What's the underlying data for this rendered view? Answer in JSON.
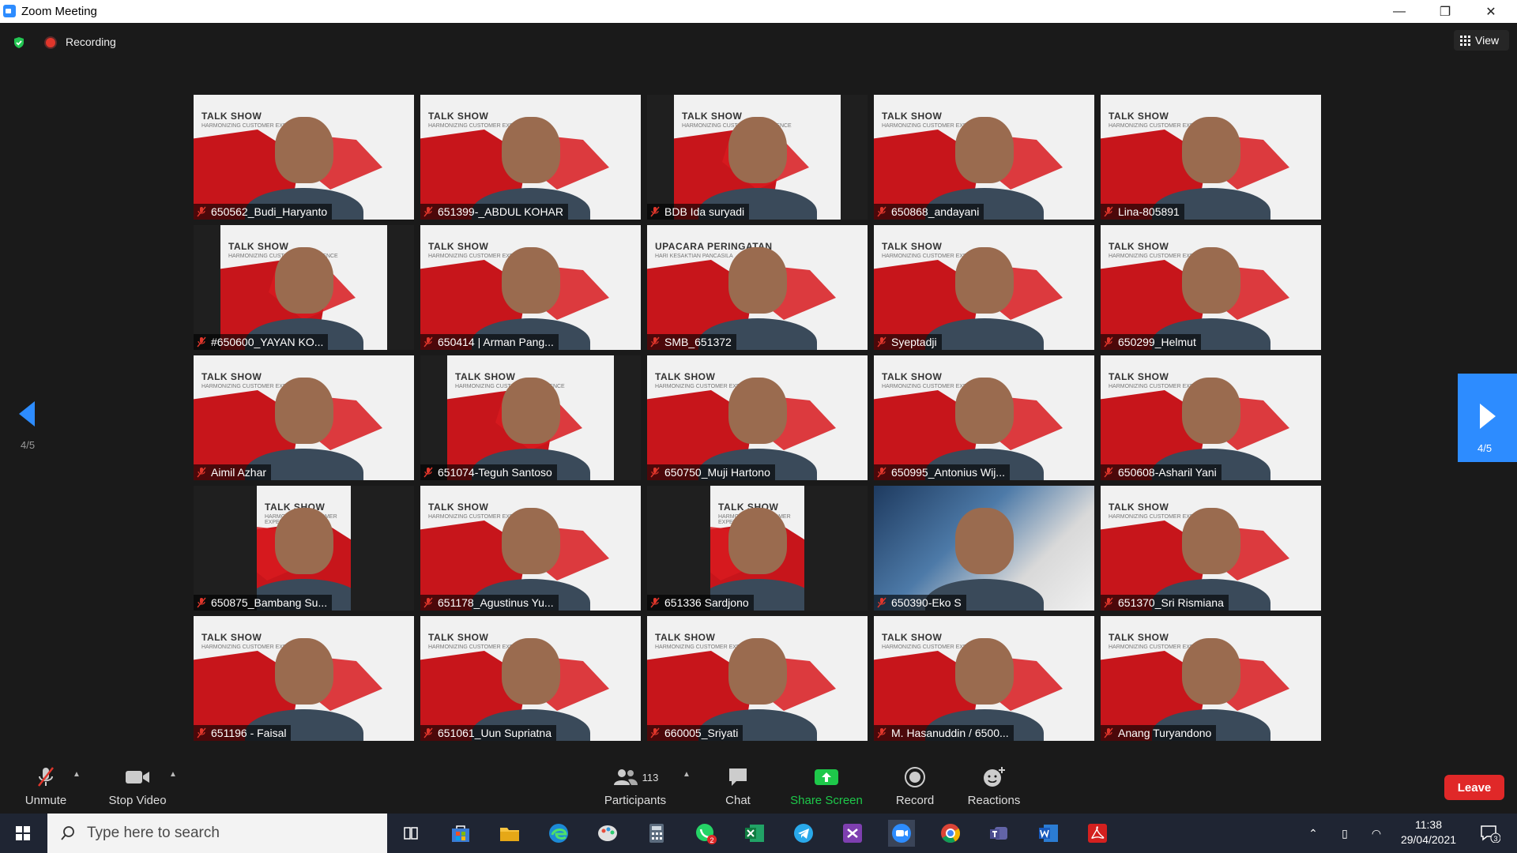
{
  "window": {
    "title": "Zoom Meeting",
    "controls": [
      "—",
      "❐",
      "✕"
    ]
  },
  "status": {
    "recording_label": "Recording",
    "view_label": "View"
  },
  "pagination": {
    "left": "4/5",
    "right": "4/5"
  },
  "participants": [
    {
      "name": "650562_Budi_Haryanto",
      "style": "talkshow"
    },
    {
      "name": "651399-_ABDUL KOHAR",
      "style": "talkshow"
    },
    {
      "name": "BDB Ida suryadi",
      "style": "dark"
    },
    {
      "name": "650868_andayani",
      "style": "talkshow"
    },
    {
      "name": "Lina-805891",
      "style": "talkshow"
    },
    {
      "name": "#650600_YAYAN KO...",
      "style": "dark"
    },
    {
      "name": "650414 | Arman Pang...",
      "style": "talkshow"
    },
    {
      "name": "SMB_651372",
      "style": "ceremony"
    },
    {
      "name": "Syeptadji",
      "style": "talkshow"
    },
    {
      "name": "650299_Helmut",
      "style": "talkshow"
    },
    {
      "name": "Aimil Azhar",
      "style": "talkshow"
    },
    {
      "name": "651074-Teguh Santoso",
      "style": "dark"
    },
    {
      "name": "650750_Muji Hartono",
      "style": "talkshow"
    },
    {
      "name": "650995_Antonius Wij...",
      "style": "talkshow"
    },
    {
      "name": "650608-Asharil Yani",
      "style": "talkshow"
    },
    {
      "name": "650875_Bambang Su...",
      "style": "narrow"
    },
    {
      "name": "651178_Agustinus Yu...",
      "style": "talkshow"
    },
    {
      "name": "651336 Sardjono",
      "style": "narrow"
    },
    {
      "name": "650390-Eko S",
      "style": "office"
    },
    {
      "name": "651370_Sri Rismiana",
      "style": "talkshow"
    },
    {
      "name": "651196 - Faisal",
      "style": "talkshow"
    },
    {
      "name": "651061_Uun Supriatna",
      "style": "talkshow"
    },
    {
      "name": "660005_Sriyati",
      "style": "talkshow"
    },
    {
      "name": "M. Hasanuddin / 6500...",
      "style": "talkshow"
    },
    {
      "name": "Anang Turyandono",
      "style": "talkshow"
    }
  ],
  "backdrop": {
    "title": "TALK SHOW",
    "subtitle": "HARMONIZING CUSTOMER EXPERIENCE",
    "ceremony_title": "UPACARA PERINGATAN",
    "ceremony_subtitle": "HARI KESAKTIAN PANCASILA"
  },
  "toolbar": {
    "unmute": "Unmute",
    "stop_video": "Stop Video",
    "participants": "Participants",
    "participants_count": "113",
    "chat": "Chat",
    "share_screen": "Share Screen",
    "record": "Record",
    "reactions": "Reactions",
    "leave": "Leave"
  },
  "taskbar": {
    "search_placeholder": "Type here to search",
    "time": "11:38",
    "date": "29/04/2021",
    "whatsapp_badge": "2",
    "notification_count": "3"
  },
  "colors": {
    "zoom_blue": "#2d8cff",
    "share_green": "#1ec84a",
    "leave_red": "#e02828",
    "backdrop_red": "#c7151b"
  }
}
